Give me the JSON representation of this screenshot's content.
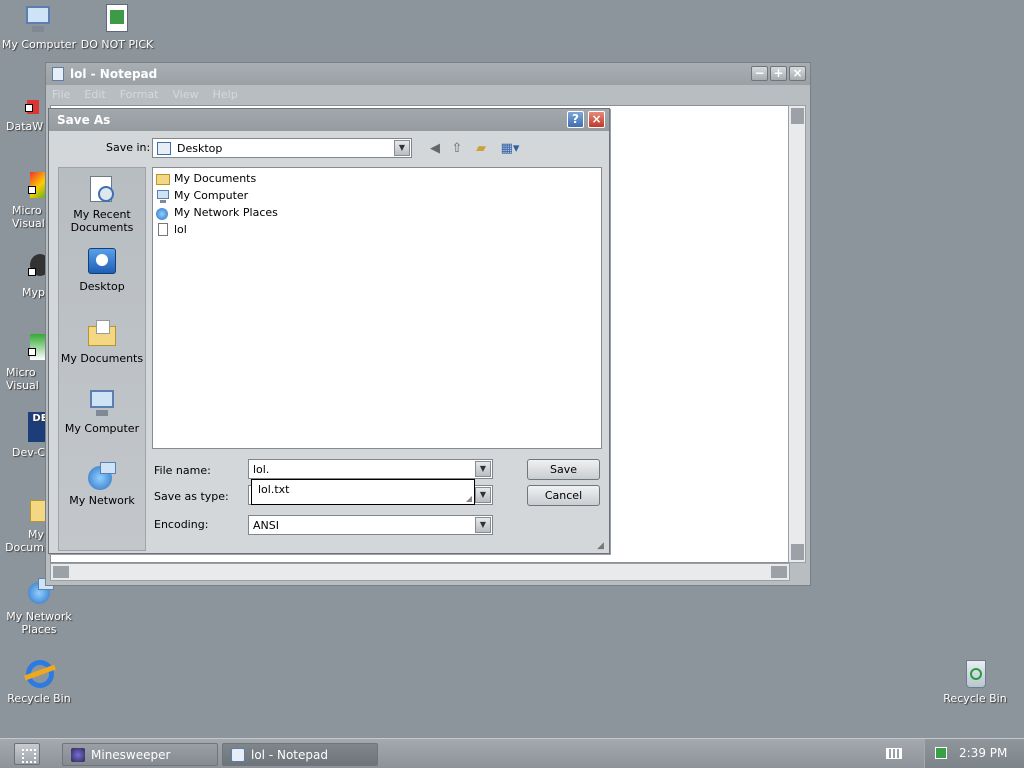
{
  "desktop": {
    "icons": [
      {
        "label": "My Computer"
      },
      {
        "label": "DO NOT PICK"
      },
      {
        "label": "DataW"
      },
      {
        "label": "Micro Visual"
      },
      {
        "label": "Myp"
      },
      {
        "label": "Micro Visual"
      },
      {
        "label": "Dev-C"
      },
      {
        "label": "My Docum"
      },
      {
        "label": "My Network Places"
      },
      {
        "label": "Recycle Bin"
      },
      {
        "label": "Recycle Bin"
      }
    ]
  },
  "notepad": {
    "title": "lol - Notepad",
    "menu": [
      "File",
      "Edit",
      "Format",
      "View",
      "Help"
    ]
  },
  "save_as": {
    "title": "Save As",
    "save_in_label": "Save in:",
    "save_in_value": "Desktop",
    "places": [
      "My Recent Documents",
      "Desktop",
      "My Documents",
      "My Computer",
      "My Network"
    ],
    "files": [
      {
        "name": "My Documents",
        "icon": "folder-icon"
      },
      {
        "name": "My Computer",
        "icon": "computer-icon"
      },
      {
        "name": "My Network Places",
        "icon": "network-icon"
      },
      {
        "name": "lol",
        "icon": "text-file-icon"
      }
    ],
    "file_name_label": "File name:",
    "file_name_value": "lol.",
    "save_as_type_label": "Save as type:",
    "autocomplete_suggestion": "lol.txt",
    "encoding_label": "Encoding:",
    "encoding_value": "ANSI",
    "save_button": "Save",
    "cancel_button": "Cancel"
  },
  "taskbar": {
    "tasks": [
      "Minesweeper",
      "lol - Notepad"
    ],
    "clock": "2:39 PM"
  },
  "colors": {
    "desktop": "#8d959c",
    "close_red": "#c0392b",
    "help_blue": "#3d6fb2"
  }
}
